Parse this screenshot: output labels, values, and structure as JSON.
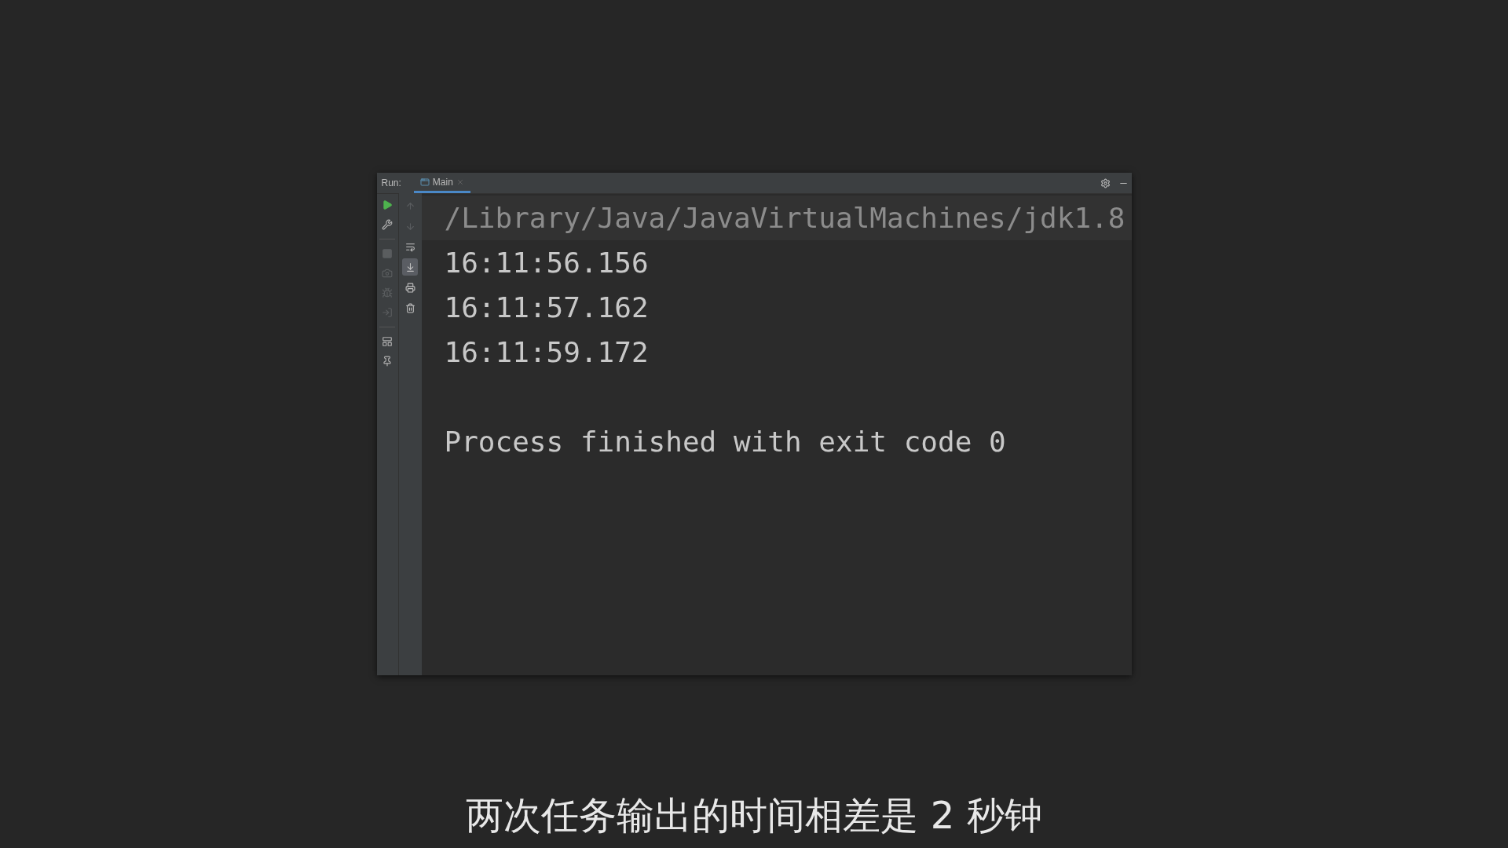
{
  "run_panel": {
    "label": "Run:",
    "tabs": [
      {
        "label": "Main",
        "selected": true
      }
    ],
    "left_toolbar": [
      {
        "disabled": false
      },
      {
        "disabled": false
      },
      {
        "disabled": true
      },
      {
        "disabled": true
      },
      {
        "disabled": true
      },
      {
        "disabled": true
      },
      {
        "disabled": false
      },
      {
        "disabled": false
      }
    ],
    "right_toolbar": [
      {
        "disabled": true,
        "selected": false
      },
      {
        "disabled": true,
        "selected": false
      },
      {
        "disabled": false,
        "selected": false
      },
      {
        "disabled": false,
        "selected": true
      },
      {
        "disabled": false,
        "selected": false
      },
      {
        "disabled": false,
        "selected": false
      }
    ],
    "console": [
      {
        "kind": "command",
        "text": "/Library/Java/JavaVirtualMachines/jdk1.8"
      },
      {
        "kind": "output",
        "text": "16:11:56.156"
      },
      {
        "kind": "output",
        "text": "16:11:57.162"
      },
      {
        "kind": "output",
        "text": "16:11:59.172"
      },
      {
        "kind": "blank"
      },
      {
        "kind": "output",
        "text": "Process finished with exit code 0"
      }
    ]
  },
  "subtitle": "两次任务输出的时间相差是 2 秒钟"
}
